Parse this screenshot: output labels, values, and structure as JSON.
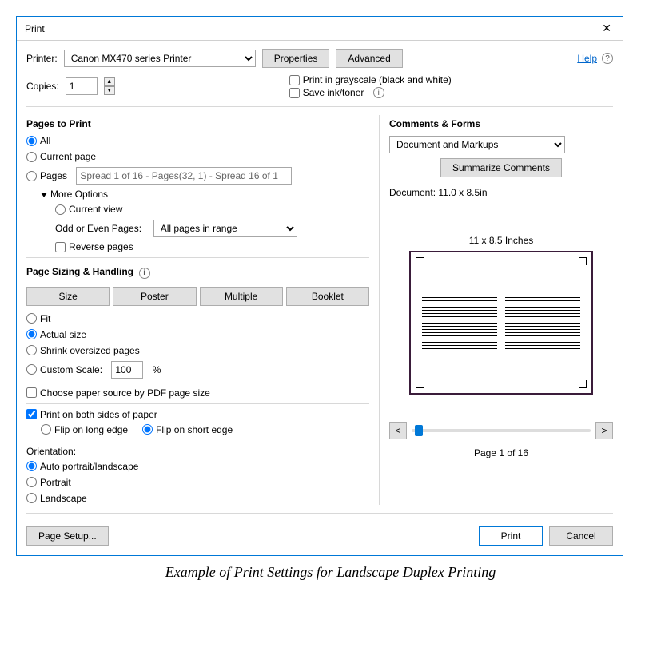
{
  "window": {
    "title": "Print",
    "close": "✕"
  },
  "top": {
    "printer_label": "Printer:",
    "printer_value": "Canon MX470 series Printer",
    "properties": "Properties",
    "advanced": "Advanced",
    "help": "Help"
  },
  "copies": {
    "label": "Copies:",
    "value": "1",
    "grayscale": "Print in grayscale (black and white)",
    "saveink": "Save ink/toner"
  },
  "pages": {
    "heading": "Pages to Print",
    "all": "All",
    "current": "Current page",
    "pages": "Pages",
    "pages_placeholder": "Spread 1 of 16 - Pages(32, 1) - Spread 16 of 1",
    "more": "More Options",
    "current_view": "Current view",
    "oddlabel": "Odd or Even Pages:",
    "oddvalue": "All pages in range",
    "reverse": "Reverse pages"
  },
  "sizing": {
    "heading": "Page Sizing & Handling",
    "tabs": {
      "size": "Size",
      "poster": "Poster",
      "multiple": "Multiple",
      "booklet": "Booklet"
    },
    "fit": "Fit",
    "actual": "Actual size",
    "shrink": "Shrink oversized pages",
    "custom": "Custom Scale:",
    "custom_value": "100",
    "custom_unit": "%",
    "paper_source": "Choose paper source by PDF page size"
  },
  "duplex": {
    "both": "Print on both sides of paper",
    "long": "Flip on long edge",
    "short": "Flip on short edge"
  },
  "orientation": {
    "label": "Orientation:",
    "auto": "Auto portrait/landscape",
    "portrait": "Portrait",
    "landscape": "Landscape"
  },
  "comments": {
    "heading": "Comments & Forms",
    "value": "Document and Markups",
    "summarize": "Summarize Comments",
    "doc_size": "Document: 11.0 x 8.5in",
    "preview_size": "11 x 8.5 Inches"
  },
  "nav": {
    "prev": "<",
    "next": ">",
    "pageof": "Page 1 of 16"
  },
  "footer": {
    "page_setup": "Page Setup...",
    "print": "Print",
    "cancel": "Cancel"
  },
  "caption": "Example of Print Settings for Landscape Duplex Printing"
}
